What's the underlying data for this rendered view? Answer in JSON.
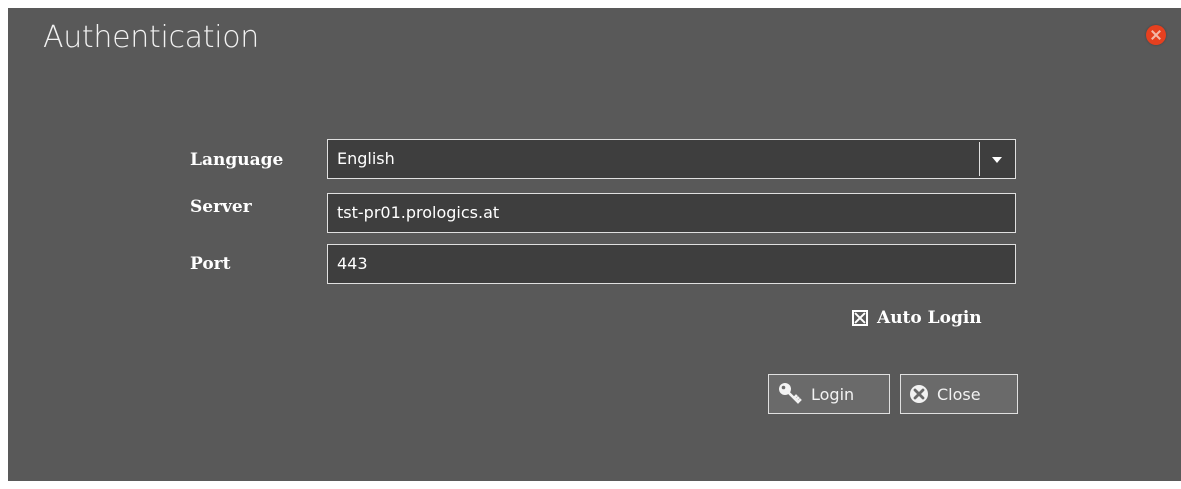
{
  "window": {
    "title": "Authentication"
  },
  "form": {
    "language": {
      "label": "Language",
      "value": "English"
    },
    "server": {
      "label": "Server",
      "value": "tst-pr01.prologics.at"
    },
    "port": {
      "label": "Port",
      "value": "443"
    },
    "auto_login": {
      "label": "Auto Login",
      "checked": true
    }
  },
  "buttons": {
    "login_label": "Login",
    "close_label": "Close"
  },
  "colors": {
    "background": "#595959",
    "field_bg": "#3e3e3e",
    "close_accent": "#e6401f"
  },
  "icons": [
    "close-icon",
    "chevron-down-icon",
    "key-icon",
    "close-circle-icon"
  ]
}
